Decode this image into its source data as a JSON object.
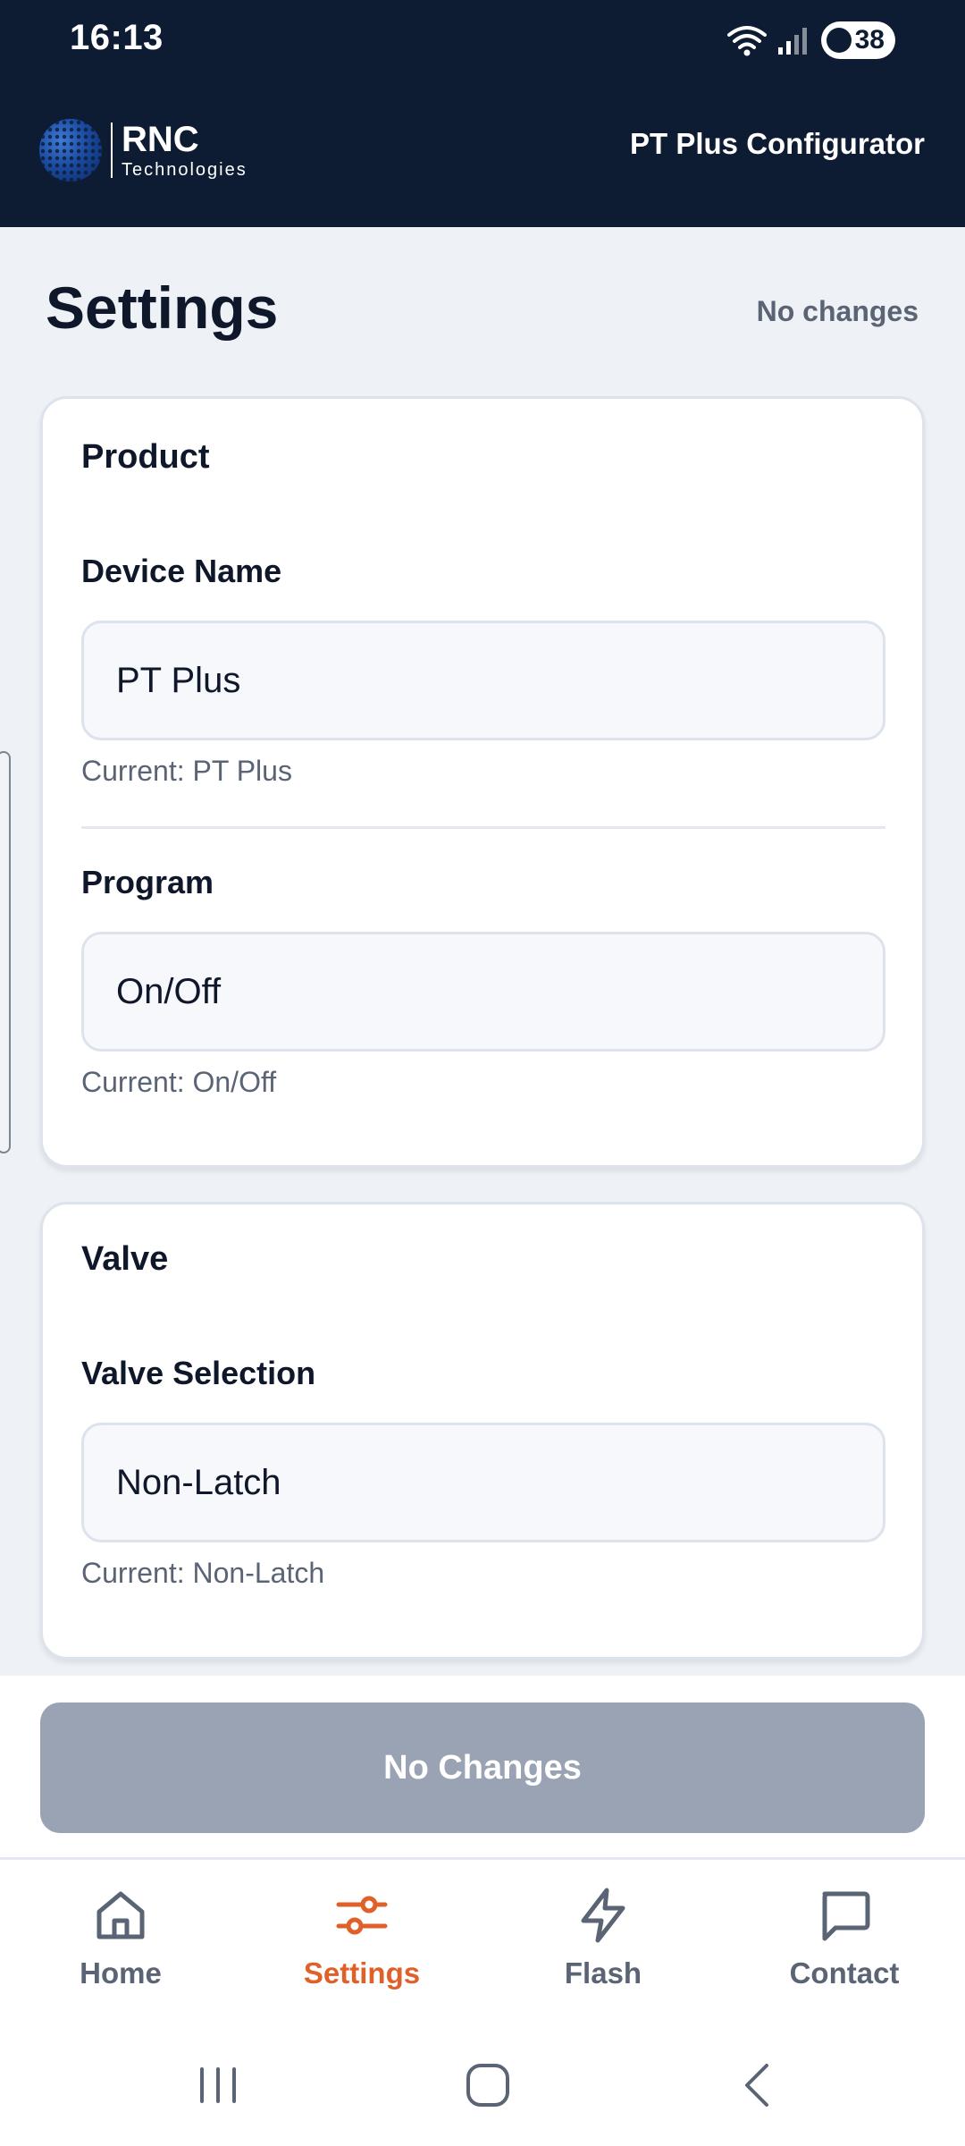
{
  "status_bar": {
    "time": "16:13",
    "battery": "38"
  },
  "header": {
    "logo_name": "RNC",
    "logo_sub": "Technologies",
    "title": "PT Plus Configurator"
  },
  "page": {
    "title": "Settings",
    "change_status": "No changes"
  },
  "product_card": {
    "heading": "Product",
    "device_name": {
      "label": "Device Name",
      "value": "PT Plus",
      "current": "Current: PT Plus"
    },
    "program": {
      "label": "Program",
      "value": "On/Off",
      "current": "Current: On/Off"
    }
  },
  "valve_card": {
    "heading": "Valve",
    "valve_selection": {
      "label": "Valve Selection",
      "value": "Non-Latch",
      "current": "Current: Non-Latch"
    }
  },
  "action": {
    "button_label": "No Changes",
    "button_color": "#9aa3b3"
  },
  "bottom_nav": {
    "active_color": "#e0602a",
    "items": [
      {
        "label": "Home",
        "icon": "home-icon"
      },
      {
        "label": "Settings",
        "icon": "sliders-icon"
      },
      {
        "label": "Flash",
        "icon": "lightning-icon"
      },
      {
        "label": "Contact",
        "icon": "chat-bubble-icon"
      }
    ]
  },
  "colors": {
    "header_bg": "#0d1b33",
    "page_bg": "#eef1f5"
  }
}
